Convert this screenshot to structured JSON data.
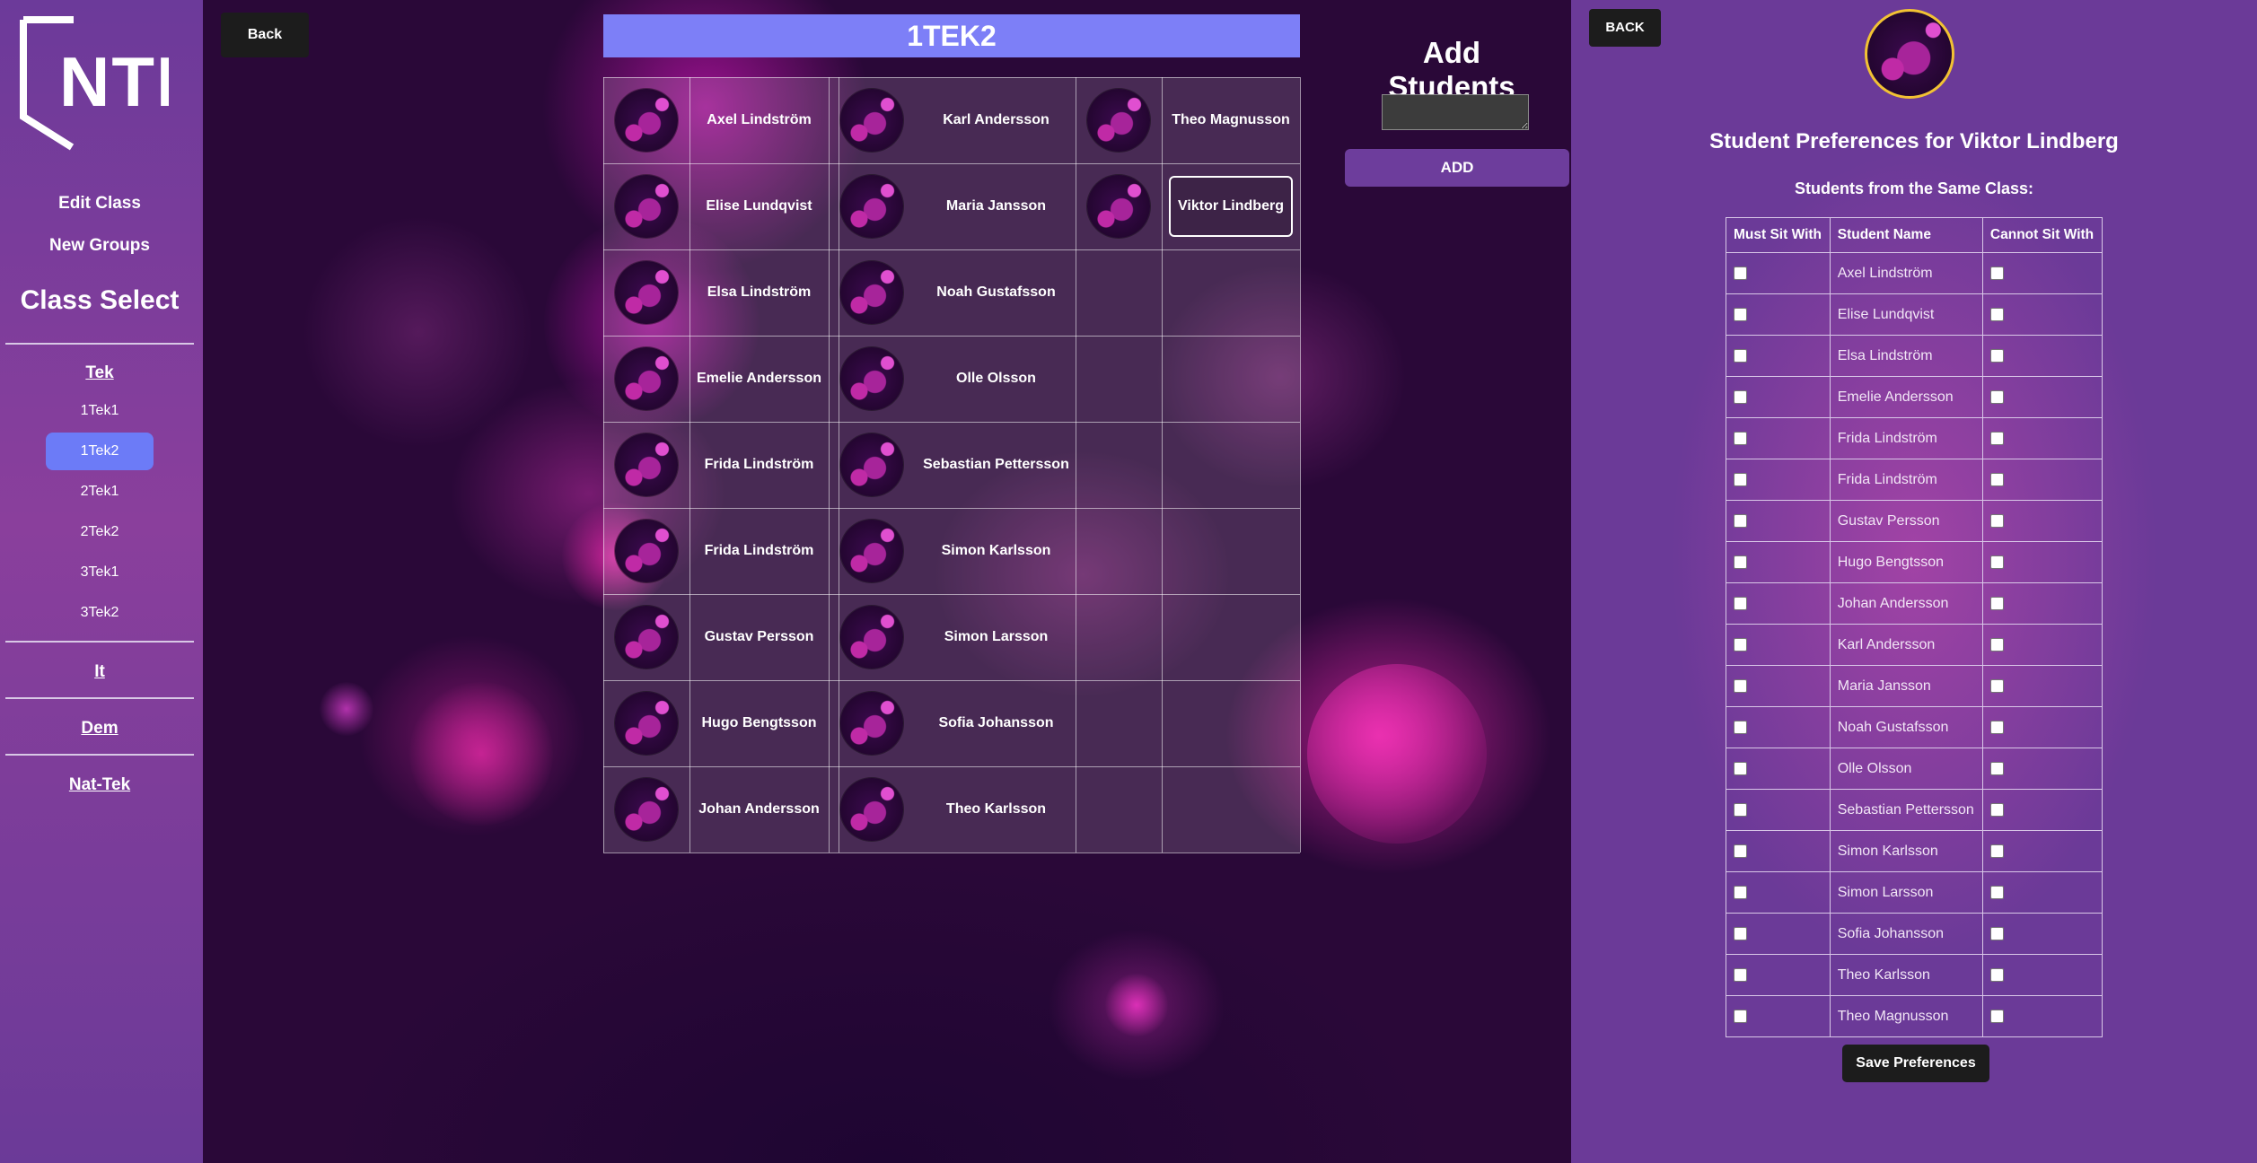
{
  "sidebar": {
    "logo_text": "NTI",
    "edit_class": "Edit Class",
    "new_groups": "New Groups",
    "class_select": "Class Select",
    "groups": [
      {
        "label": "Tek",
        "classes": [
          "1Tek1",
          "1Tek2",
          "2Tek1",
          "2Tek2",
          "3Tek1",
          "3Tek2"
        ]
      },
      {
        "label": "It"
      },
      {
        "label": "Dem"
      },
      {
        "label": "Nat-Tek"
      }
    ],
    "selected_class": "1Tek2",
    "selected_color": "#6c7bf7"
  },
  "main": {
    "back_label": "Back",
    "class_title": "1TEK2",
    "seating_columns": [
      [
        "Axel Lindström",
        "Elise Lundqvist",
        "Elsa Lindström",
        "Emelie Andersson",
        "Frida Lindström",
        "Frida Lindström",
        "Gustav Persson",
        "Hugo Bengtsson",
        "Johan Andersson"
      ],
      [
        "Karl Andersson",
        "Maria Jansson",
        "Noah Gustafsson",
        "Olle Olsson",
        "Sebastian Pettersson",
        "Simon Karlsson",
        "Simon Larsson",
        "Sofia Johansson",
        "Theo Karlsson"
      ],
      [
        "Theo Magnusson",
        "Viktor Lindberg"
      ]
    ],
    "selected_student": "Viktor Lindberg",
    "add_students": {
      "title": "Add Students",
      "input_value": "",
      "button_label": "ADD"
    }
  },
  "preferences": {
    "back_label": "BACK",
    "title": "Student Preferences for Viktor Lindberg",
    "subtitle": "Students from the Same Class:",
    "headers": [
      "Must Sit With",
      "Student Name",
      "Cannot Sit With"
    ],
    "rows": [
      {
        "name": "Axel Lindström",
        "must": false,
        "cannot": false
      },
      {
        "name": "Elise Lundqvist",
        "must": false,
        "cannot": false
      },
      {
        "name": "Elsa Lindström",
        "must": false,
        "cannot": false
      },
      {
        "name": "Emelie Andersson",
        "must": false,
        "cannot": false
      },
      {
        "name": "Frida Lindström",
        "must": false,
        "cannot": false
      },
      {
        "name": "Frida Lindström",
        "must": false,
        "cannot": false
      },
      {
        "name": "Gustav Persson",
        "must": false,
        "cannot": false
      },
      {
        "name": "Hugo Bengtsson",
        "must": false,
        "cannot": false
      },
      {
        "name": "Johan Andersson",
        "must": false,
        "cannot": false
      },
      {
        "name": "Karl Andersson",
        "must": false,
        "cannot": false
      },
      {
        "name": "Maria Jansson",
        "must": false,
        "cannot": false
      },
      {
        "name": "Noah Gustafsson",
        "must": false,
        "cannot": false
      },
      {
        "name": "Olle Olsson",
        "must": false,
        "cannot": false
      },
      {
        "name": "Sebastian Pettersson",
        "must": false,
        "cannot": false
      },
      {
        "name": "Simon Karlsson",
        "must": false,
        "cannot": false
      },
      {
        "name": "Simon Larsson",
        "must": false,
        "cannot": false
      },
      {
        "name": "Sofia Johansson",
        "must": false,
        "cannot": false
      },
      {
        "name": "Theo Karlsson",
        "must": false,
        "cannot": false
      },
      {
        "name": "Theo Magnusson",
        "must": false,
        "cannot": false
      }
    ],
    "save_label": "Save Preferences"
  }
}
